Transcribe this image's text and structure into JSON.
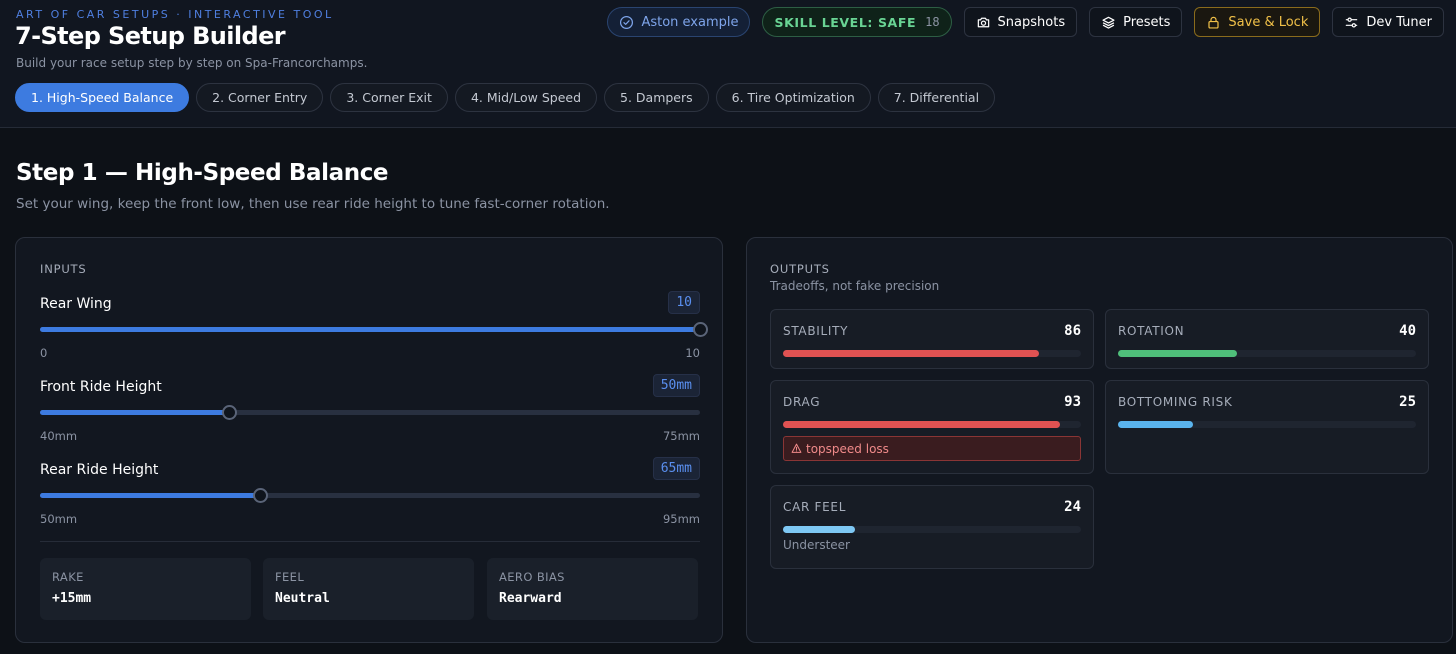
{
  "header": {
    "eyebrow": "ART OF CAR SETUPS · INTERACTIVE TOOL",
    "title": "7-Step Setup Builder",
    "subtitle": "Build your race setup step by step on Spa-Francorchamps."
  },
  "toolbar": {
    "example_label": "Aston example",
    "skill_label": "SKILL LEVEL: SAFE",
    "skill_count": "18",
    "snapshots_label": "Snapshots",
    "presets_label": "Presets",
    "save_lock_label": "Save & Lock",
    "dev_tuner_label": "Dev Tuner"
  },
  "tabs": [
    {
      "label": "1. High-Speed Balance",
      "active": true
    },
    {
      "label": "2. Corner Entry",
      "active": false
    },
    {
      "label": "3. Corner Exit",
      "active": false
    },
    {
      "label": "4. Mid/Low Speed",
      "active": false
    },
    {
      "label": "5. Dampers",
      "active": false
    },
    {
      "label": "6. Tire Optimization",
      "active": false
    },
    {
      "label": "7. Differential",
      "active": false
    }
  ],
  "step": {
    "title": "Step 1 — High-Speed Balance",
    "subtitle": "Set your wing, keep the front low, then use rear ride height to tune fast-corner rotation."
  },
  "inputs": {
    "label": "INPUTS",
    "sliders": [
      {
        "name": "Rear Wing",
        "value_display": "10",
        "value": 10,
        "min": 0,
        "max": 10,
        "min_label": "0",
        "max_label": "10"
      },
      {
        "name": "Front Ride Height",
        "value_display": "50mm",
        "value": 50,
        "min": 40,
        "max": 75,
        "min_label": "40mm",
        "max_label": "75mm"
      },
      {
        "name": "Rear Ride Height",
        "value_display": "65mm",
        "value": 65,
        "min": 50,
        "max": 95,
        "min_label": "50mm",
        "max_label": "95mm"
      }
    ],
    "stats": [
      {
        "label": "RAKE",
        "value": "+15mm"
      },
      {
        "label": "FEEL",
        "value": "Neutral"
      },
      {
        "label": "AERO BIAS",
        "value": "Rearward"
      }
    ]
  },
  "outputs": {
    "label": "OUTPUTS",
    "hint": "Tradeoffs, not fake precision",
    "cards": [
      {
        "label": "STABILITY",
        "value": "86",
        "fraction": 0.86,
        "color": "#e05252"
      },
      {
        "label": "ROTATION",
        "value": "40",
        "fraction": 0.4,
        "color": "#4fbf7a"
      },
      {
        "label": "DRAG",
        "value": "93",
        "fraction": 0.93,
        "color": "#e05252",
        "warning": "topspeed loss"
      },
      {
        "label": "BOTTOMING RISK",
        "value": "25",
        "fraction": 0.25,
        "color": "#5ab4ee"
      },
      {
        "label": "CAR FEEL",
        "value": "24",
        "fraction": 0.24,
        "color": "#7ec8f4",
        "note": "Understeer"
      }
    ]
  },
  "colors": {
    "accent": "#3d7be0",
    "background": "#0d1117",
    "panel": "#121720",
    "save_accent": "#f0c048",
    "skill_accent": "#69d494"
  }
}
